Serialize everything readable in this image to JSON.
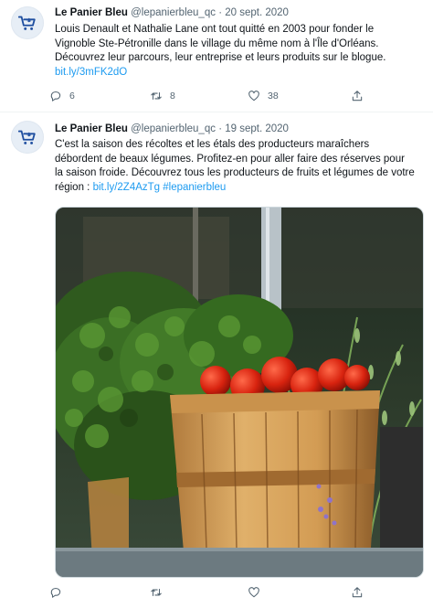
{
  "tweets": [
    {
      "name": "Le Panier Bleu",
      "handle": "@lepanierbleu_qc",
      "separator": "·",
      "date": "20 sept. 2020",
      "text": "Louis Denault et Nathalie Lane ont tout quitté en 2003 pour fonder le Vignoble Ste-Pétronille dans le village du même nom à l'Île d'Orléans. Découvrez leur parcours, leur entreprise et leurs produits sur le blogue.",
      "link": "bit.ly/3mFK2dO",
      "replies": "6",
      "retweets": "8",
      "likes": "38"
    },
    {
      "name": "Le Panier Bleu",
      "handle": "@lepanierbleu_qc",
      "separator": "·",
      "date": "19 sept. 2020",
      "text": "C'est la saison des récoltes et les étals des producteurs maraîchers débordent de beaux légumes. Profitez-en pour aller faire des réserves pour la saison froide. Découvrez tous les producteurs de fruits et légumes de votre région :",
      "link": "bit.ly/2Z4AzTg",
      "hashtag": "#lepanierbleu",
      "replies": "",
      "retweets": "",
      "likes": ""
    }
  ],
  "icons": {
    "avatar": "blue-cart-fleur-de-lis-logo",
    "reply": "reply-icon",
    "retweet": "retweet-icon",
    "like": "heart-icon",
    "share": "share-icon"
  },
  "colors": {
    "link": "#1d9bf0",
    "secondary_text": "#536471",
    "brand_blue": "#1f4fa0"
  }
}
